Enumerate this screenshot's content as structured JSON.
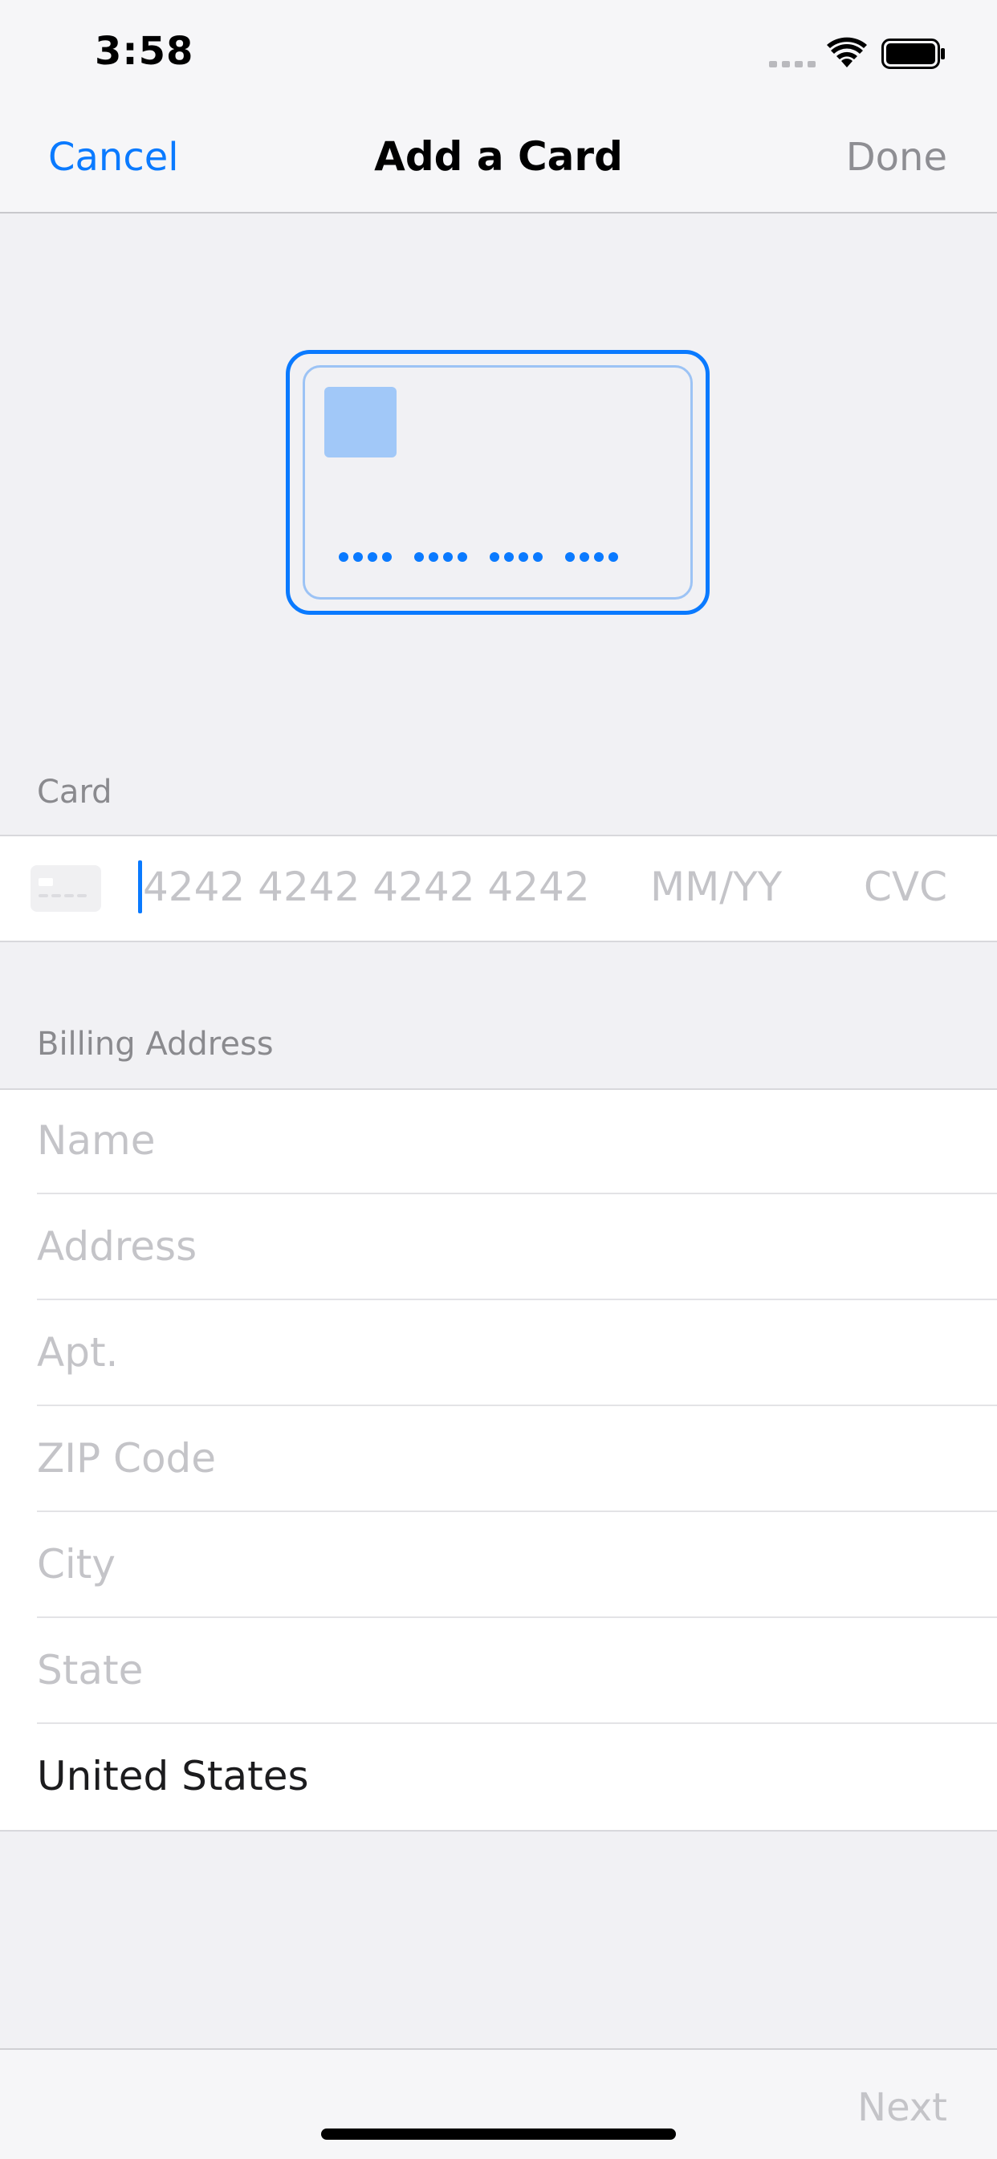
{
  "status_bar": {
    "time": "3:58",
    "icons": [
      "signal-icon",
      "wifi-icon",
      "battery-icon"
    ]
  },
  "nav": {
    "cancel_label": "Cancel",
    "title": "Add a Card",
    "done_label": "Done"
  },
  "card_section": {
    "header": "Card",
    "card_number_placeholder": "4242 4242 4242 4242",
    "expiry_placeholder": "MM/YY",
    "cvc_placeholder": "CVC"
  },
  "billing_section": {
    "header": "Billing Address",
    "fields": [
      {
        "placeholder": "Name"
      },
      {
        "placeholder": "Address"
      },
      {
        "placeholder": "Apt."
      },
      {
        "placeholder": "ZIP Code"
      },
      {
        "placeholder": "City"
      },
      {
        "placeholder": "State"
      }
    ],
    "country_value": "United States"
  },
  "footer": {
    "next_label": "Next"
  },
  "colors": {
    "accent": "#0a7aff",
    "placeholder": "#c4c4c8",
    "secondary_text": "#8a8a8e",
    "background": "#f1f1f4"
  }
}
